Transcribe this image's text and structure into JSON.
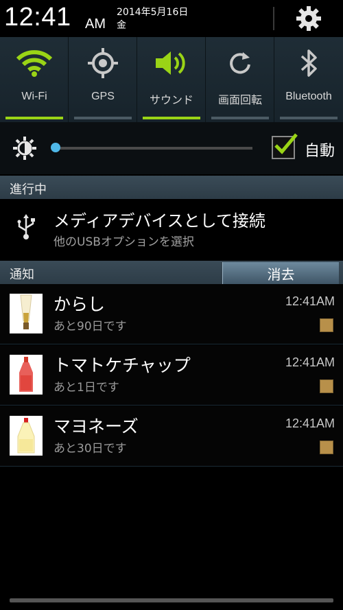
{
  "status": {
    "time": "12:41",
    "ampm": "AM",
    "date_line1": "2014年5月16日",
    "date_line2": "金"
  },
  "toggles": [
    {
      "label": "Wi-Fi",
      "icon": "wifi-icon",
      "on": true
    },
    {
      "label": "GPS",
      "icon": "gps-icon",
      "on": false
    },
    {
      "label": "サウンド",
      "icon": "sound-icon",
      "on": true
    },
    {
      "label": "画面回転",
      "icon": "rotate-icon",
      "on": false
    },
    {
      "label": "Bluetooth",
      "icon": "bluetooth-icon",
      "on": false
    }
  ],
  "brightness": {
    "level": 0.0,
    "auto_label": "自動",
    "auto_checked": true
  },
  "ongoing": {
    "header": "進行中",
    "title": "メディアデバイスとして接続",
    "subtitle": "他のUSBオプションを選択"
  },
  "notifications_section": {
    "header": "通知",
    "clear_label": "消去"
  },
  "notifications": [
    {
      "title": "からし",
      "subtitle": "あと90日です",
      "time": "12:41AM",
      "thumb": "mustard-tube"
    },
    {
      "title": "トマトケチャップ",
      "subtitle": "あと1日です",
      "time": "12:41AM",
      "thumb": "ketchup-bottle"
    },
    {
      "title": "マヨネーズ",
      "subtitle": "あと30日です",
      "time": "12:41AM",
      "thumb": "mayonnaise-bottle"
    }
  ],
  "colors": {
    "accent_on": "#9ad416",
    "slider": "#4fb8e8"
  }
}
